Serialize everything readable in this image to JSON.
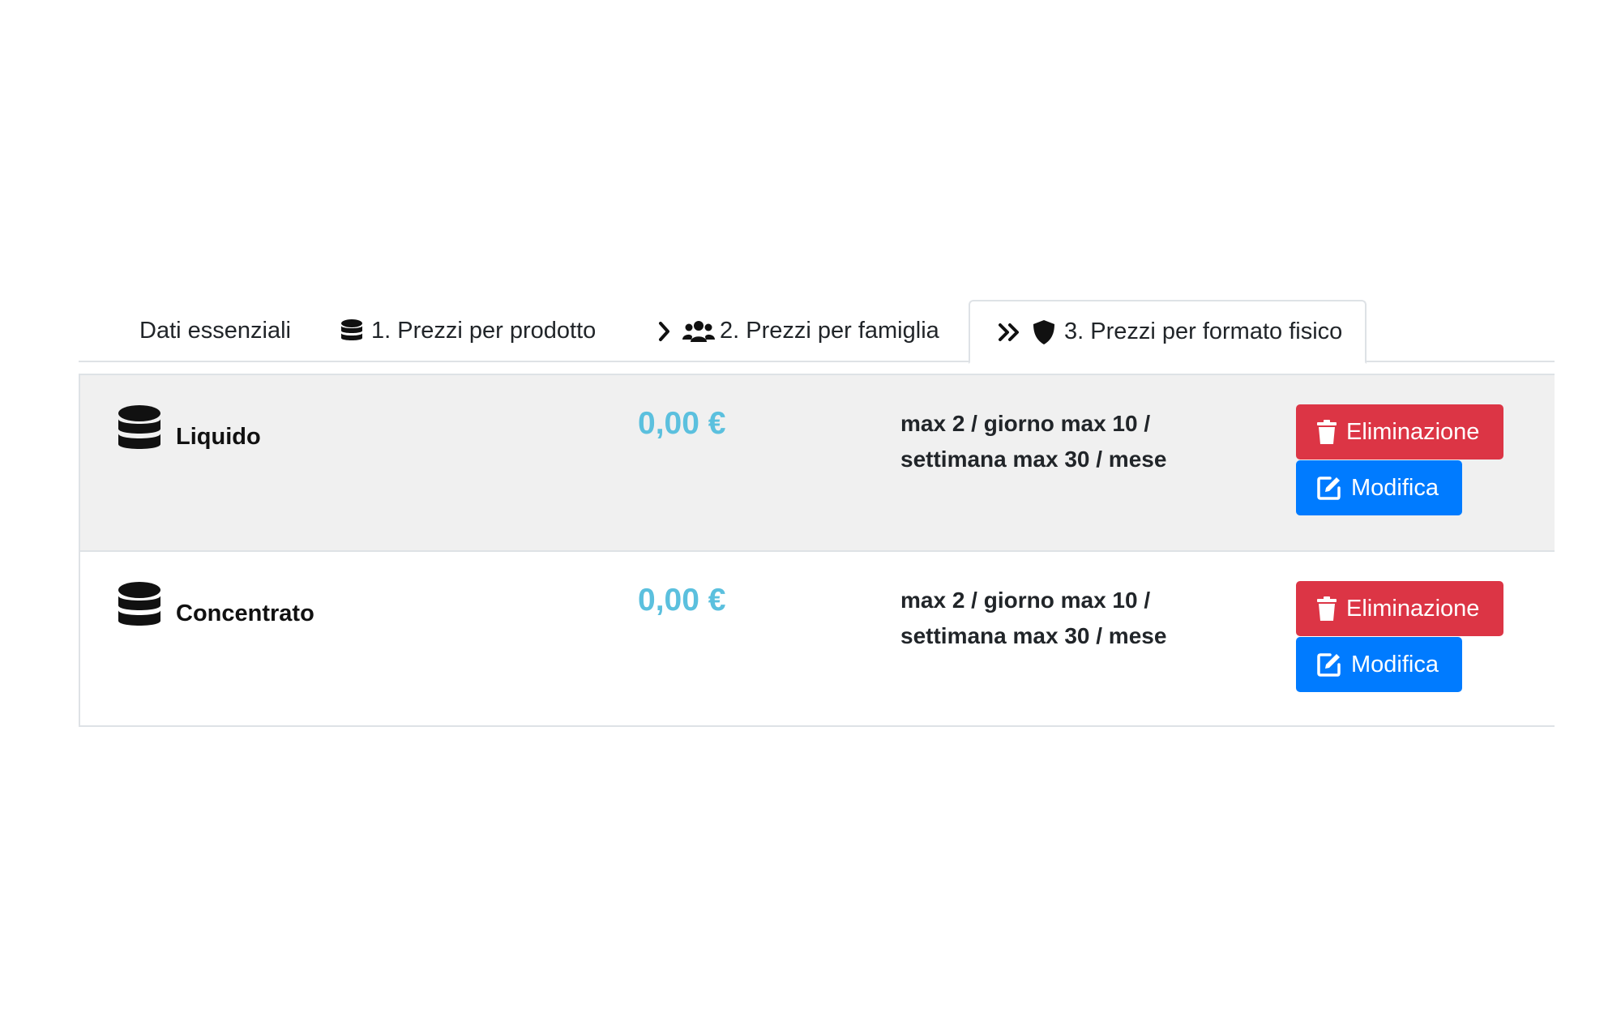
{
  "tabs": [
    {
      "label": "Dati essenziali",
      "icon": ""
    },
    {
      "label": "1. Prezzi per prodotto",
      "icon": "database-icon"
    },
    {
      "label": "2. Prezzi per famiglia",
      "icon": "users-icon",
      "prefix_icon": "chevron-right-icon"
    },
    {
      "label": "3. Prezzi per formato fisico",
      "icon": "shield-icon",
      "prefix_icon": "double-chevron-right-icon",
      "active": true
    }
  ],
  "items": [
    {
      "name": "Liquido",
      "price": "0,00 €",
      "limits_line1": "max 2 / giorno max 10 /",
      "limits_line2": "settimana max 30 / mese",
      "delete_label": "Eliminazione",
      "edit_label": "Modifica"
    },
    {
      "name": "Concentrato",
      "price": "0,00 €",
      "limits_line1": "max 2 / giorno max 10 /",
      "limits_line2": "settimana max 30 / mese",
      "delete_label": "Eliminazione",
      "edit_label": "Modifica"
    }
  ],
  "colors": {
    "price": "#5bc0de",
    "danger": "#dc3545",
    "primary": "#007bff",
    "row_shaded": "#f0f0f0"
  }
}
